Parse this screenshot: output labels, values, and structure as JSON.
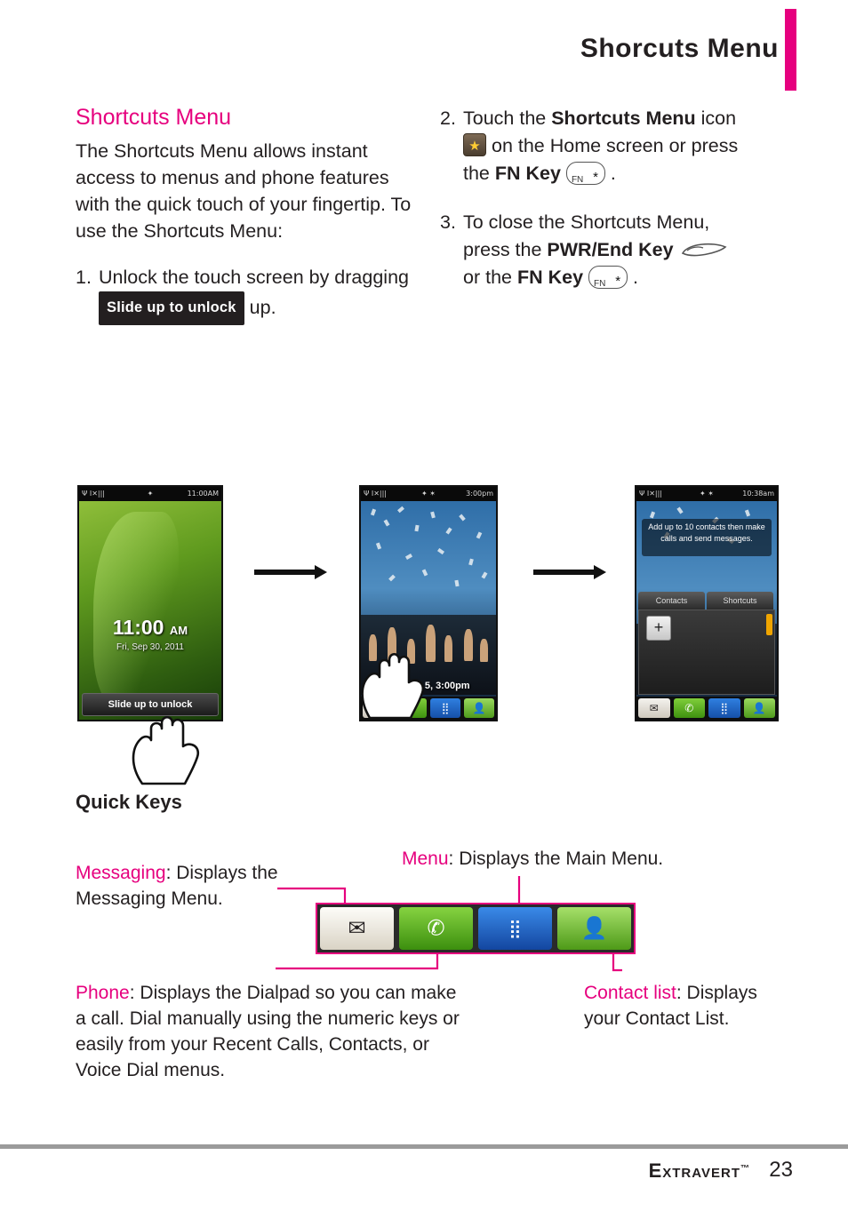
{
  "header": {
    "title": "Shorcuts Menu"
  },
  "left": {
    "section_title": "Shortcuts Menu",
    "intro": "The Shortcuts Menu allows instant access to menus and phone features with the quick touch of your fingertip. To use the Shortcuts Menu:",
    "step1": {
      "num": "1.",
      "pre": "Unlock the touch screen by dragging",
      "pill": "Slide up to unlock",
      "post": "up."
    }
  },
  "right": {
    "step2": {
      "num": "2.",
      "pre": "Touch the",
      "bold1": "Shortcuts Menu",
      "mid": "icon",
      "line2": "on the Home screen or press",
      "line3_pre": "the",
      "bold2": "FN Key",
      "line3_post": "."
    },
    "step3": {
      "num": "3.",
      "line1": "To close the Shortcuts Menu,",
      "line2_pre": "press the",
      "bold1": "PWR/End Key",
      "line3_pre": "or the",
      "bold2": "FN Key",
      "line3_post": "."
    }
  },
  "phones": {
    "p1": {
      "status_left": "Ψ I✕|||",
      "status_icons": "✦",
      "status_right": "11:00AM",
      "time": "11:00",
      "ampm": "AM",
      "date": "Fri, Sep 30, 2011",
      "slide": "Slide up to unlock"
    },
    "p2": {
      "status_left": "Ψ I✕|||",
      "status_icons": "✦ ✶",
      "status_right": "3:00pm",
      "datetime": "Nov 5, 3:00pm"
    },
    "p3": {
      "status_left": "Ψ I✕|||",
      "status_icons": "✦ ✶",
      "status_right": "10:38am",
      "banner": "Add up to 10 contacts then make calls and send messages.",
      "tab1": "Contacts",
      "tab2": "Shortcuts",
      "plus": "+"
    }
  },
  "quick_keys": {
    "title": "Quick Keys",
    "messaging": {
      "name": "Messaging",
      "text": ": Displays the Messaging Menu."
    },
    "menu": {
      "name": "Menu",
      "text": ": Displays the Main Menu."
    },
    "phone": {
      "name": "Phone",
      "text": ": Displays the Dialpad so you can make a call. Dial manually using the numeric keys or easily from your Recent Calls, Contacts, or Voice Dial menus."
    },
    "contact": {
      "name": "Contact list",
      "text": ": Displays your Contact List."
    }
  },
  "footer": {
    "brand": "Extravert",
    "tm": "™",
    "page": "23"
  },
  "colors": {
    "accent": "#e6007e",
    "text": "#231f20"
  }
}
